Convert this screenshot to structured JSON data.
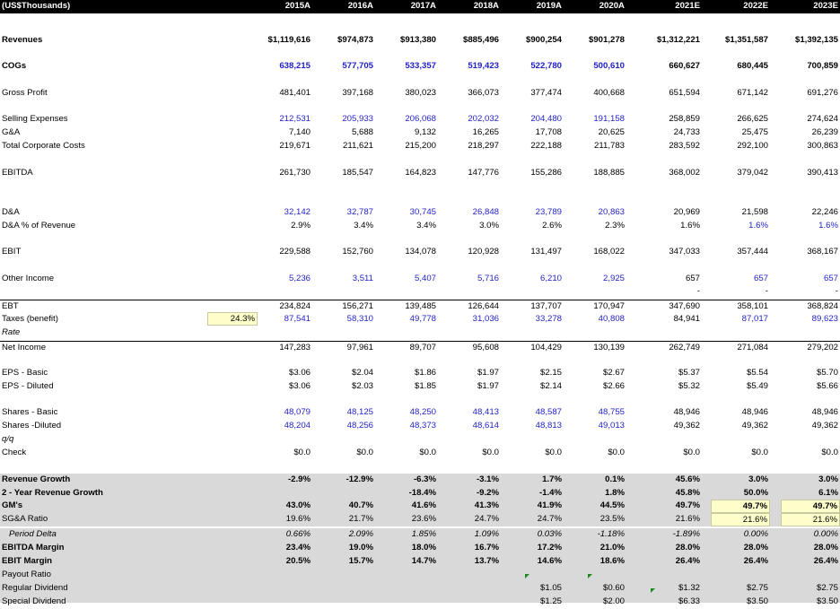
{
  "header": {
    "title": "(US$Thousands)",
    "years": [
      "2015A",
      "2016A",
      "2017A",
      "2018A",
      "2019A",
      "2020A",
      "2021E",
      "2022E",
      "2023E"
    ]
  },
  "rows": [
    {
      "label": "Revenues",
      "values": [
        "$1,119,616",
        "$974,873",
        "$913,380",
        "$885,496",
        "$900,254",
        "$901,278",
        "$1,312,221",
        "$1,351,587",
        "$1,392,135"
      ]
    },
    {
      "label": "COGs",
      "values": [
        "638,215",
        "577,705",
        "533,357",
        "519,423",
        "522,780",
        "500,610",
        "660,627",
        "680,445",
        "700,859"
      ]
    },
    {
      "label": "Gross Profit",
      "values": [
        "481,401",
        "397,168",
        "380,023",
        "366,073",
        "377,474",
        "400,668",
        "651,594",
        "671,142",
        "691,276"
      ]
    },
    {
      "label": "Selling Expenses",
      "values": [
        "212,531",
        "205,933",
        "206,068",
        "202,032",
        "204,480",
        "191,158",
        "258,859",
        "266,625",
        "274,624"
      ]
    },
    {
      "label": "G&A",
      "values": [
        "7,140",
        "5,688",
        "9,132",
        "16,265",
        "17,708",
        "20,625",
        "24,733",
        "25,475",
        "26,239"
      ]
    },
    {
      "label": "Total Corporate Costs",
      "values": [
        "219,671",
        "211,621",
        "215,200",
        "218,297",
        "222,188",
        "211,783",
        "283,592",
        "292,100",
        "300,863"
      ]
    },
    {
      "label": "EBITDA",
      "values": [
        "261,730",
        "185,547",
        "164,823",
        "147,776",
        "155,286",
        "188,885",
        "368,002",
        "379,042",
        "390,413"
      ]
    },
    {
      "label": "D&A",
      "values": [
        "32,142",
        "32,787",
        "30,745",
        "26,848",
        "23,789",
        "20,863",
        "20,969",
        "21,598",
        "22,246"
      ]
    },
    {
      "label": "D&A % of Revenue",
      "values": [
        "2.9%",
        "3.4%",
        "3.4%",
        "3.0%",
        "2.6%",
        "2.3%",
        "1.6%",
        "1.6%",
        "1.6%"
      ]
    },
    {
      "label": "EBIT",
      "values": [
        "229,588",
        "152,760",
        "134,078",
        "120,928",
        "131,497",
        "168,022",
        "347,033",
        "357,444",
        "368,167"
      ]
    },
    {
      "label": "Other Income",
      "values": [
        "5,236",
        "3,511",
        "5,407",
        "5,716",
        "6,210",
        "2,925",
        "657",
        "657",
        "657"
      ]
    },
    {
      "label": "",
      "values": [
        "",
        "",
        "",
        "",
        "",
        "",
        "-",
        "-",
        "-"
      ]
    },
    {
      "label": "EBT",
      "values": [
        "234,824",
        "156,271",
        "139,485",
        "126,644",
        "137,707",
        "170,947",
        "347,690",
        "358,101",
        "368,824"
      ]
    },
    {
      "label": "Taxes (benefit)",
      "rate": "24.3%",
      "values": [
        "87,541",
        "58,310",
        "49,778",
        "31,036",
        "33,278",
        "40,808",
        "84,941",
        "87,017",
        "89,623"
      ]
    },
    {
      "label": "Rate",
      "values": [
        "",
        "",
        "",
        "",
        "",
        "",
        "",
        "",
        ""
      ]
    },
    {
      "label": "Net Income",
      "values": [
        "147,283",
        "97,961",
        "89,707",
        "95,608",
        "104,429",
        "130,139",
        "262,749",
        "271,084",
        "279,202"
      ]
    },
    {
      "label": "EPS - Basic",
      "values": [
        "$3.06",
        "$2.04",
        "$1.86",
        "$1.97",
        "$2.15",
        "$2.67",
        "$5.37",
        "$5.54",
        "$5.70"
      ]
    },
    {
      "label": "EPS - Diluted",
      "values": [
        "$3.06",
        "$2.03",
        "$1.85",
        "$1.97",
        "$2.14",
        "$2.66",
        "$5.32",
        "$5.49",
        "$5.66"
      ]
    },
    {
      "label": "Shares - Basic",
      "values": [
        "48,079",
        "48,125",
        "48,250",
        "48,413",
        "48,587",
        "48,755",
        "48,946",
        "48,946",
        "48,946"
      ]
    },
    {
      "label": "Shares -Diluted",
      "values": [
        "48,204",
        "48,256",
        "48,373",
        "48,614",
        "48,813",
        "49,013",
        "49,362",
        "49,362",
        "49,362"
      ]
    },
    {
      "label": "q/q",
      "values": [
        "",
        "",
        "",
        "",
        "",
        "",
        "",
        "",
        ""
      ]
    },
    {
      "label": "Check",
      "values": [
        "$0.0",
        "$0.0",
        "$0.0",
        "$0.0",
        "$0.0",
        "$0.0",
        "$0.0",
        "$0.0",
        "$0.0"
      ]
    },
    {
      "label": "Revenue Growth",
      "values": [
        "-2.9%",
        "-12.9%",
        "-6.3%",
        "-3.1%",
        "1.7%",
        "0.1%",
        "45.6%",
        "3.0%",
        "3.0%"
      ]
    },
    {
      "label": "2 - Year Revenue Growth",
      "values": [
        "",
        "",
        "-18.4%",
        "-9.2%",
        "-1.4%",
        "1.8%",
        "45.8%",
        "50.0%",
        "6.1%"
      ]
    },
    {
      "label": "GM's",
      "values": [
        "43.0%",
        "40.7%",
        "41.6%",
        "41.3%",
        "41.9%",
        "44.5%",
        "49.7%",
        "49.7%",
        "49.7%"
      ]
    },
    {
      "label": "SG&A Ratio",
      "values": [
        "19.6%",
        "21.7%",
        "23.6%",
        "24.7%",
        "24.7%",
        "23.5%",
        "21.6%",
        "21.6%",
        "21.6%"
      ]
    },
    {
      "label": "Period Delta",
      "values": [
        "0.66%",
        "2.09%",
        "1.85%",
        "1.09%",
        "0.03%",
        "-1.18%",
        "-1.89%",
        "0.00%",
        "0.00%"
      ]
    },
    {
      "label": "EBITDA Margin",
      "values": [
        "23.4%",
        "19.0%",
        "18.0%",
        "16.7%",
        "17.2%",
        "21.0%",
        "28.0%",
        "28.0%",
        "28.0%"
      ]
    },
    {
      "label": "EBIT Margin",
      "values": [
        "20.5%",
        "15.7%",
        "14.7%",
        "13.7%",
        "14.6%",
        "18.6%",
        "26.4%",
        "26.4%",
        "26.4%"
      ]
    },
    {
      "label": "Payout Ratio",
      "values": [
        "",
        "",
        "",
        "",
        "",
        "",
        "",
        "",
        ""
      ]
    },
    {
      "label": "Regular Dividend",
      "values": [
        "",
        "",
        "",
        "",
        "$1.05",
        "$0.60",
        "$1.32",
        "$2.75",
        "$2.75"
      ]
    },
    {
      "label": "Special Dividend",
      "values": [
        "",
        "",
        "",
        "",
        "$1.25",
        "$2.00",
        "$6.33",
        "$3.50",
        "$3.50"
      ]
    }
  ],
  "colors": {
    "header_bg": "#000000",
    "input_blue": "#1f1fc8",
    "ratio_section_bg": "#d9d9d9",
    "input_cell_bg": "#ffffcc",
    "comment_flag": "#1a8a1a"
  }
}
